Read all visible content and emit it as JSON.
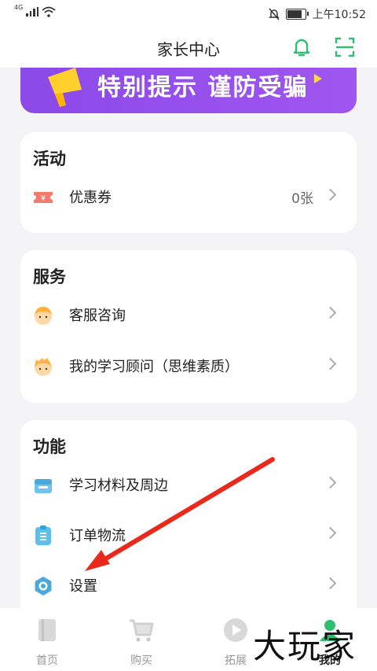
{
  "status_bar": {
    "network": "4G",
    "time": "上午10:52"
  },
  "header": {
    "title": "家长中心"
  },
  "banner": {
    "text": "特别提示 谨防受骗"
  },
  "activity": {
    "title": "活动",
    "items": [
      {
        "label": "优惠券",
        "value": "0张",
        "icon": "coupon-icon"
      }
    ]
  },
  "service": {
    "title": "服务",
    "items": [
      {
        "label": "客服咨询",
        "icon": "customer-service-avatar-icon"
      },
      {
        "label": "我的学习顾问（思维素质）",
        "icon": "advisor-avatar-icon"
      }
    ]
  },
  "features": {
    "title": "功能",
    "items": [
      {
        "label": "学习材料及周边",
        "icon": "shop-icon"
      },
      {
        "label": "订单物流",
        "icon": "clipboard-icon"
      },
      {
        "label": "设置",
        "icon": "settings-icon"
      }
    ]
  },
  "tabbar": {
    "items": [
      {
        "label": "首页",
        "active": false
      },
      {
        "label": "购买",
        "active": false
      },
      {
        "label": "拓展",
        "active": false
      },
      {
        "label": "我的",
        "active": true
      }
    ]
  },
  "watermark": "大玩家",
  "colors": {
    "accent": "#2fbf71",
    "banner": "#9450ec",
    "annotation_arrow": "#e8291c"
  }
}
